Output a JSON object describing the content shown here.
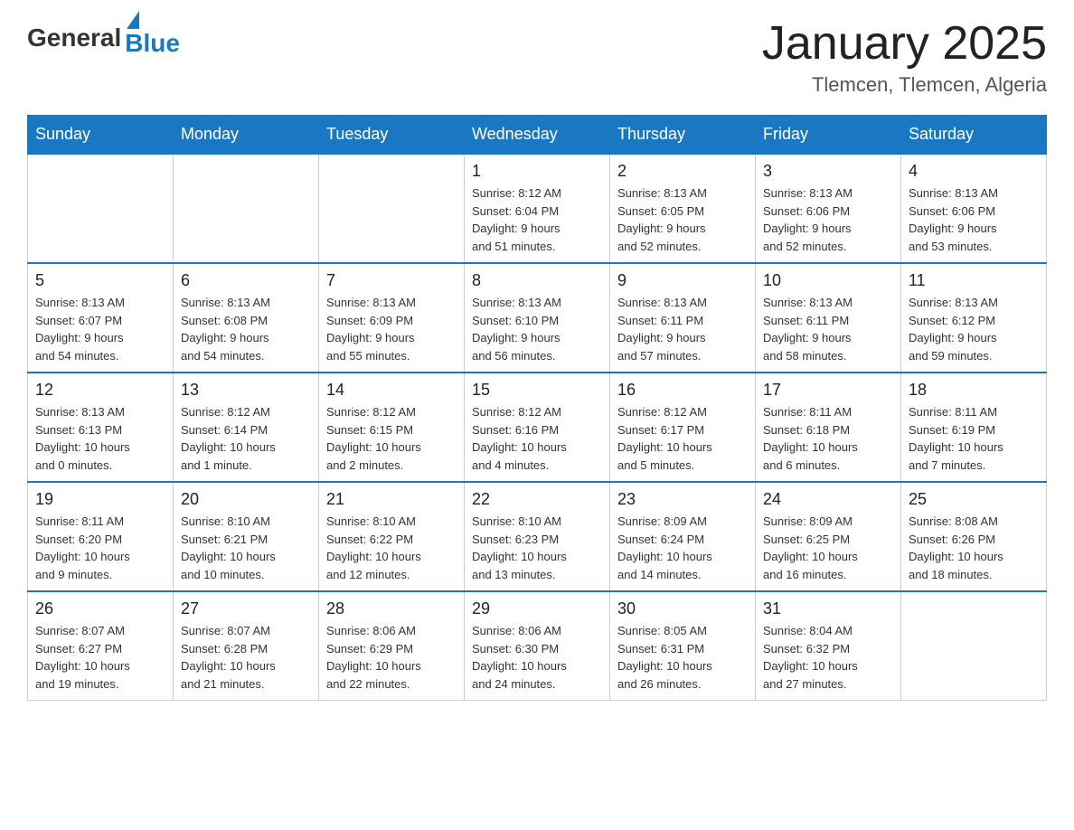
{
  "logo": {
    "text_general": "General",
    "text_blue": "Blue"
  },
  "title": "January 2025",
  "subtitle": "Tlemcen, Tlemcen, Algeria",
  "days_of_week": [
    "Sunday",
    "Monday",
    "Tuesday",
    "Wednesday",
    "Thursday",
    "Friday",
    "Saturday"
  ],
  "weeks": [
    [
      {
        "day": "",
        "info": ""
      },
      {
        "day": "",
        "info": ""
      },
      {
        "day": "",
        "info": ""
      },
      {
        "day": "1",
        "info": "Sunrise: 8:12 AM\nSunset: 6:04 PM\nDaylight: 9 hours\nand 51 minutes."
      },
      {
        "day": "2",
        "info": "Sunrise: 8:13 AM\nSunset: 6:05 PM\nDaylight: 9 hours\nand 52 minutes."
      },
      {
        "day": "3",
        "info": "Sunrise: 8:13 AM\nSunset: 6:06 PM\nDaylight: 9 hours\nand 52 minutes."
      },
      {
        "day": "4",
        "info": "Sunrise: 8:13 AM\nSunset: 6:06 PM\nDaylight: 9 hours\nand 53 minutes."
      }
    ],
    [
      {
        "day": "5",
        "info": "Sunrise: 8:13 AM\nSunset: 6:07 PM\nDaylight: 9 hours\nand 54 minutes."
      },
      {
        "day": "6",
        "info": "Sunrise: 8:13 AM\nSunset: 6:08 PM\nDaylight: 9 hours\nand 54 minutes."
      },
      {
        "day": "7",
        "info": "Sunrise: 8:13 AM\nSunset: 6:09 PM\nDaylight: 9 hours\nand 55 minutes."
      },
      {
        "day": "8",
        "info": "Sunrise: 8:13 AM\nSunset: 6:10 PM\nDaylight: 9 hours\nand 56 minutes."
      },
      {
        "day": "9",
        "info": "Sunrise: 8:13 AM\nSunset: 6:11 PM\nDaylight: 9 hours\nand 57 minutes."
      },
      {
        "day": "10",
        "info": "Sunrise: 8:13 AM\nSunset: 6:11 PM\nDaylight: 9 hours\nand 58 minutes."
      },
      {
        "day": "11",
        "info": "Sunrise: 8:13 AM\nSunset: 6:12 PM\nDaylight: 9 hours\nand 59 minutes."
      }
    ],
    [
      {
        "day": "12",
        "info": "Sunrise: 8:13 AM\nSunset: 6:13 PM\nDaylight: 10 hours\nand 0 minutes."
      },
      {
        "day": "13",
        "info": "Sunrise: 8:12 AM\nSunset: 6:14 PM\nDaylight: 10 hours\nand 1 minute."
      },
      {
        "day": "14",
        "info": "Sunrise: 8:12 AM\nSunset: 6:15 PM\nDaylight: 10 hours\nand 2 minutes."
      },
      {
        "day": "15",
        "info": "Sunrise: 8:12 AM\nSunset: 6:16 PM\nDaylight: 10 hours\nand 4 minutes."
      },
      {
        "day": "16",
        "info": "Sunrise: 8:12 AM\nSunset: 6:17 PM\nDaylight: 10 hours\nand 5 minutes."
      },
      {
        "day": "17",
        "info": "Sunrise: 8:11 AM\nSunset: 6:18 PM\nDaylight: 10 hours\nand 6 minutes."
      },
      {
        "day": "18",
        "info": "Sunrise: 8:11 AM\nSunset: 6:19 PM\nDaylight: 10 hours\nand 7 minutes."
      }
    ],
    [
      {
        "day": "19",
        "info": "Sunrise: 8:11 AM\nSunset: 6:20 PM\nDaylight: 10 hours\nand 9 minutes."
      },
      {
        "day": "20",
        "info": "Sunrise: 8:10 AM\nSunset: 6:21 PM\nDaylight: 10 hours\nand 10 minutes."
      },
      {
        "day": "21",
        "info": "Sunrise: 8:10 AM\nSunset: 6:22 PM\nDaylight: 10 hours\nand 12 minutes."
      },
      {
        "day": "22",
        "info": "Sunrise: 8:10 AM\nSunset: 6:23 PM\nDaylight: 10 hours\nand 13 minutes."
      },
      {
        "day": "23",
        "info": "Sunrise: 8:09 AM\nSunset: 6:24 PM\nDaylight: 10 hours\nand 14 minutes."
      },
      {
        "day": "24",
        "info": "Sunrise: 8:09 AM\nSunset: 6:25 PM\nDaylight: 10 hours\nand 16 minutes."
      },
      {
        "day": "25",
        "info": "Sunrise: 8:08 AM\nSunset: 6:26 PM\nDaylight: 10 hours\nand 18 minutes."
      }
    ],
    [
      {
        "day": "26",
        "info": "Sunrise: 8:07 AM\nSunset: 6:27 PM\nDaylight: 10 hours\nand 19 minutes."
      },
      {
        "day": "27",
        "info": "Sunrise: 8:07 AM\nSunset: 6:28 PM\nDaylight: 10 hours\nand 21 minutes."
      },
      {
        "day": "28",
        "info": "Sunrise: 8:06 AM\nSunset: 6:29 PM\nDaylight: 10 hours\nand 22 minutes."
      },
      {
        "day": "29",
        "info": "Sunrise: 8:06 AM\nSunset: 6:30 PM\nDaylight: 10 hours\nand 24 minutes."
      },
      {
        "day": "30",
        "info": "Sunrise: 8:05 AM\nSunset: 6:31 PM\nDaylight: 10 hours\nand 26 minutes."
      },
      {
        "day": "31",
        "info": "Sunrise: 8:04 AM\nSunset: 6:32 PM\nDaylight: 10 hours\nand 27 minutes."
      },
      {
        "day": "",
        "info": ""
      }
    ]
  ]
}
